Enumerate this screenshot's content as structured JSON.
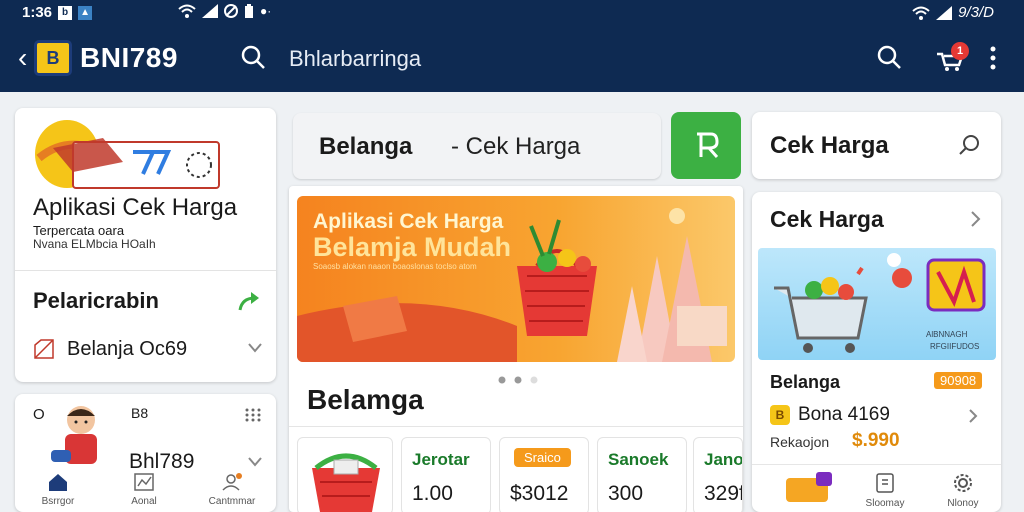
{
  "status_bar": {
    "time": "1:36",
    "right_text": "9/3/D",
    "icons": [
      "notification-icon",
      "image-icon",
      "wifi-icon",
      "signal-icon",
      "no-data-icon",
      "battery-icon",
      "dots-icon"
    ]
  },
  "app_bar": {
    "brand": "BNI789",
    "search_text": "Bhlarbarringa",
    "cart_badge": "1",
    "colors": {
      "background": "#0e2a52",
      "logo": "#f5c518"
    }
  },
  "left_panel": {
    "title": "Aplikasi Cek Harga",
    "subtitle_1": "Terpercata oara",
    "subtitle_2": "Nvana ELMbcia HOaIh",
    "section_title": "Pelaricrabin",
    "row_label": "Belanja Oc69",
    "mini_card": {
      "time_label": "O",
      "tiny_label": "B8",
      "name": "Bhl789"
    },
    "bottom_nav": [
      "Bsrrgor",
      "Aonal",
      "Cantmmar"
    ]
  },
  "center": {
    "search_primary": "Belanga",
    "search_secondary": "- Cek Harga",
    "banner": {
      "line1": "Aplikasi Cek Harga",
      "line2": "Belamja Mudah",
      "line3": "Soaosb alokan naaon boaoslonas toclso atom"
    },
    "section_title": "Belamga",
    "items": [
      {
        "label": "",
        "value": ""
      },
      {
        "label": "Jerotar",
        "value": "1.00"
      },
      {
        "label": "Sraico",
        "value": "$3012"
      },
      {
        "label": "Sanoek",
        "value": "300"
      },
      {
        "label": "Jano",
        "value": "329f"
      }
    ],
    "colors": {
      "green_button": "#3cb043",
      "accent_orange": "#f59a1b"
    }
  },
  "right_panel": {
    "top_title": "Cek Harga",
    "section_title": "Cek Harga",
    "image_caption_1": "AlBNNAGH",
    "image_caption_2": "RFGIIFUDOS",
    "product_name": "Belanga",
    "product_tag": "90908",
    "row_label": "Bona 4169",
    "row3_label": "Rekaojon",
    "row3_price": "$.990",
    "bottom_nav": [
      "",
      "Sloomay",
      "Nlonoy"
    ]
  }
}
